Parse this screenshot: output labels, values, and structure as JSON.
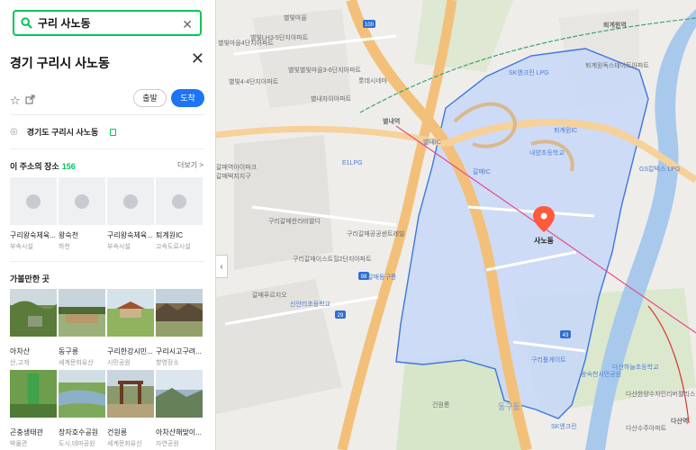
{
  "search": {
    "query": "구리 사노동"
  },
  "place": {
    "title": "경기 구리시 사노동",
    "start_label": "출발",
    "arrive_label": "도착",
    "address": "경기도 구리시 사노동"
  },
  "places_section": {
    "heading": "이 주소의 장소",
    "count": "156",
    "more": "더보기 >",
    "items": [
      {
        "name": "구리왕숙체육...",
        "category": "부속시설"
      },
      {
        "name": "왕숙천",
        "category": "하천"
      },
      {
        "name": "구리왕숙체육...",
        "category": "부속시설"
      },
      {
        "name": "퇴계원IC",
        "category": "고속도로시설"
      }
    ]
  },
  "visit_section": {
    "heading": "가볼만한 곳",
    "items": [
      {
        "name": "아차산",
        "category": "산,고개"
      },
      {
        "name": "동구릉",
        "category": "세계문화유산"
      },
      {
        "name": "구리한강시민...",
        "category": "시민공원"
      },
      {
        "name": "구리시고구려...",
        "category": "향영장소"
      },
      {
        "name": "곤충생태관",
        "category": "박물관"
      },
      {
        "name": "장자호수공원",
        "category": "도시,테마공원"
      },
      {
        "name": "건원릉",
        "category": "세계문화유산"
      },
      {
        "name": "아차산해맞이...",
        "category": "자연공원"
      }
    ]
  },
  "map": {
    "district_marker": "사노동",
    "labels": [
      "별빛마을",
      "별빛마을4단지아파트",
      "별빛LH3-5단지아파트",
      "별빛4-4단지아파트",
      "별빛별빛마을3-6단지아파트",
      "별내자이아파트",
      "롯데시네마",
      "별내역",
      "퇴계원역",
      "퇴계원독스테이트아파트",
      "SK엔크린 LPG",
      "E1LPG",
      "갈매역아이파크",
      "갈매택지지구",
      "구리갈매한라비발디",
      "구리갈매공공센트레빌",
      "구리갈매이스트힐2단지아파트",
      "갈매푸르지오",
      "신안리초등학교",
      "갈매동구릉",
      "내양초등학교",
      "GS칼텍스 LPG",
      "구리톨게이트",
      "왕숙천시민공원",
      "다산하늘초등학교",
      "다산한양수자인리버팰리스",
      "다산수주아파트",
      "다산역",
      "SK엔크린",
      "동구동",
      "건원릉",
      "퇴계원IC",
      "별내IC",
      "갈매IC"
    ],
    "road_shields": [
      "100",
      "29",
      "43",
      "98"
    ],
    "colors": {
      "district_fill": "#c9d8f7",
      "district_border": "#3d75e0",
      "highway": "#f3c07a",
      "river": "#a8c9ec",
      "marker": "#ff5a3c"
    }
  }
}
